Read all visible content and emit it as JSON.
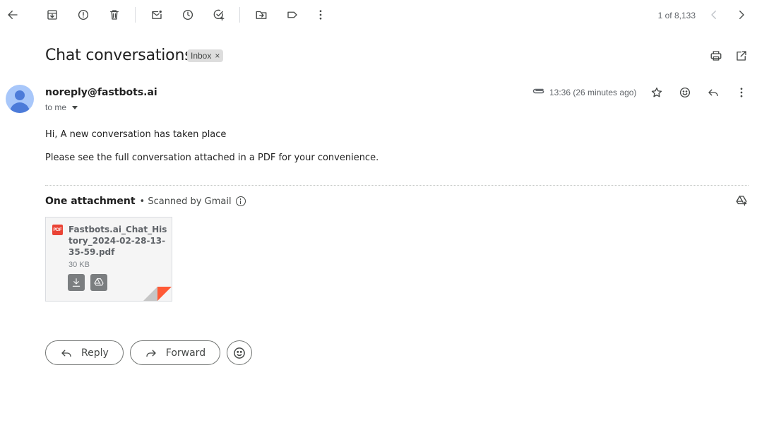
{
  "toolbar": {
    "icons": [
      "back-arrow-icon",
      "archive-icon",
      "report-spam-icon",
      "delete-icon",
      "mark-unread-icon",
      "snooze-icon",
      "add-to-tasks-icon",
      "move-to-icon",
      "label-icon",
      "more-vert-icon"
    ],
    "counter": "1 of 8,133"
  },
  "subject": {
    "title": "Chat conversations",
    "label_chip": "Inbox",
    "label_remove": "×"
  },
  "message": {
    "sender": "noreply@fastbots.ai",
    "recipient": "to me",
    "time": "13:36 (26 minutes ago)",
    "body": [
      "Hi, A new conversation has taken place",
      "Please see the full conversation attached in a PDF for your convenience."
    ]
  },
  "attachments": {
    "heading": "One attachment",
    "scanned": "• Scanned by Gmail",
    "file": {
      "type_badge": "PDF",
      "name": "Fastbots.ai_Chat_History_2024-02-28-13-35-59.pdf",
      "size": "30 KB"
    }
  },
  "actions": {
    "reply": "Reply",
    "forward": "Forward"
  },
  "colors": {
    "accent_red": "#ea4335",
    "avatar_bg": "#a8c7fa",
    "avatar_fg": "#4c7bd9"
  }
}
